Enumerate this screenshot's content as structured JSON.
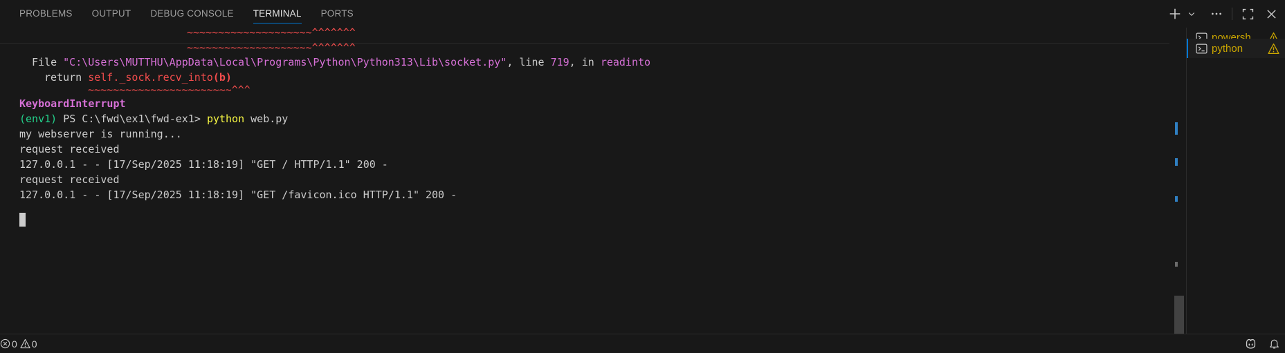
{
  "panel": {
    "tabs": [
      {
        "label": "PROBLEMS"
      },
      {
        "label": "OUTPUT"
      },
      {
        "label": "DEBUG CONSOLE"
      },
      {
        "label": "TERMINAL"
      },
      {
        "label": "PORTS"
      }
    ],
    "active_tab": "TERMINAL"
  },
  "terminal": {
    "lines": {
      "squiggle_1": "~~~~~~~~~~~~~~~~~~~~^^^^^^^",
      "squiggle_2": "~~~~~~~~~~~~~~~~~~~~^^^^^^^",
      "file_prefix": "File ",
      "file_path": "\"C:\\Users\\MUTTHU\\AppData\\Local\\Programs\\Python\\Python313\\Lib\\socket.py\"",
      "file_line_label": ", line ",
      "file_line_num": "719",
      "file_in_label": ", in ",
      "file_func": "readinto",
      "return_keyword": "return ",
      "return_expr": "self._sock.recv_into",
      "return_args": "(b)",
      "squiggle_3": "~~~~~~~~~~~~~~~~~~~~~~~^^^",
      "interrupt": "KeyboardInterrupt",
      "prompt_env": "(env1)",
      "prompt_path": " PS C:\\fwd\\ex1\\fwd-ex1> ",
      "cmd_name": "python",
      "cmd_args": " web.py",
      "out_1": "my webserver is running...",
      "out_2": "request received",
      "out_3": "127.0.0.1 - - [17/Sep/2025 11:18:19] \"GET / HTTP/1.1\" 200 -",
      "out_4": "request received",
      "out_5": "127.0.0.1 - - [17/Sep/2025 11:18:19] \"GET /favicon.ico HTTP/1.1\" 200 -"
    }
  },
  "terminal_list": [
    {
      "name": "powersh...",
      "icon": "terminal-icon",
      "status_icon": "warning-icon"
    },
    {
      "name": "python",
      "icon": "terminal-icon",
      "status_icon": "warning-icon",
      "selected": true
    }
  ],
  "status_bar": {
    "errors": "0",
    "warnings": "0"
  },
  "colors": {
    "background": "#181818",
    "accent": "#0078d4",
    "warning": "#cca700",
    "terminal_magenta": "#d670d6",
    "terminal_red": "#f14c4c",
    "terminal_green": "#23d18b",
    "terminal_yellow": "#f5f543"
  }
}
